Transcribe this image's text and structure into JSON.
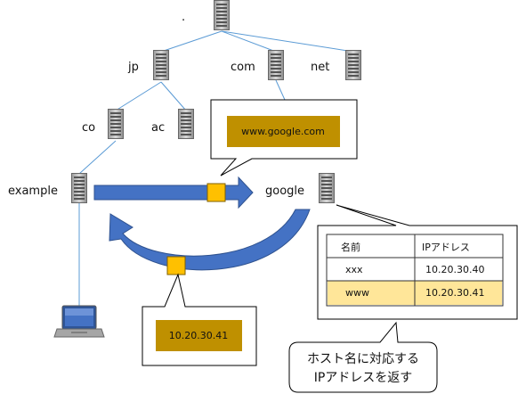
{
  "nodes": {
    "root": ".",
    "jp": "jp",
    "com": "com",
    "net": "net",
    "co": "co",
    "ac": "ac",
    "example": "example",
    "google": "google"
  },
  "query_label": "www.google.com",
  "answer_label": "10.20.30.41",
  "dns_table": {
    "headers": [
      "名前",
      "IPアドレス"
    ],
    "rows": [
      {
        "name": "xxx",
        "ip": "10.20.30.40",
        "highlighted": false
      },
      {
        "name": "www",
        "ip": "10.20.30.41",
        "highlighted": true
      }
    ]
  },
  "note": [
    "ホスト名に対応する",
    "IPアドレスを返す"
  ],
  "colors": {
    "arrow": "#4472C4",
    "packet": "#FFC000",
    "label_box": "#BF9000",
    "highlight_row": "#FFE699",
    "line": "#5B9BD5"
  }
}
